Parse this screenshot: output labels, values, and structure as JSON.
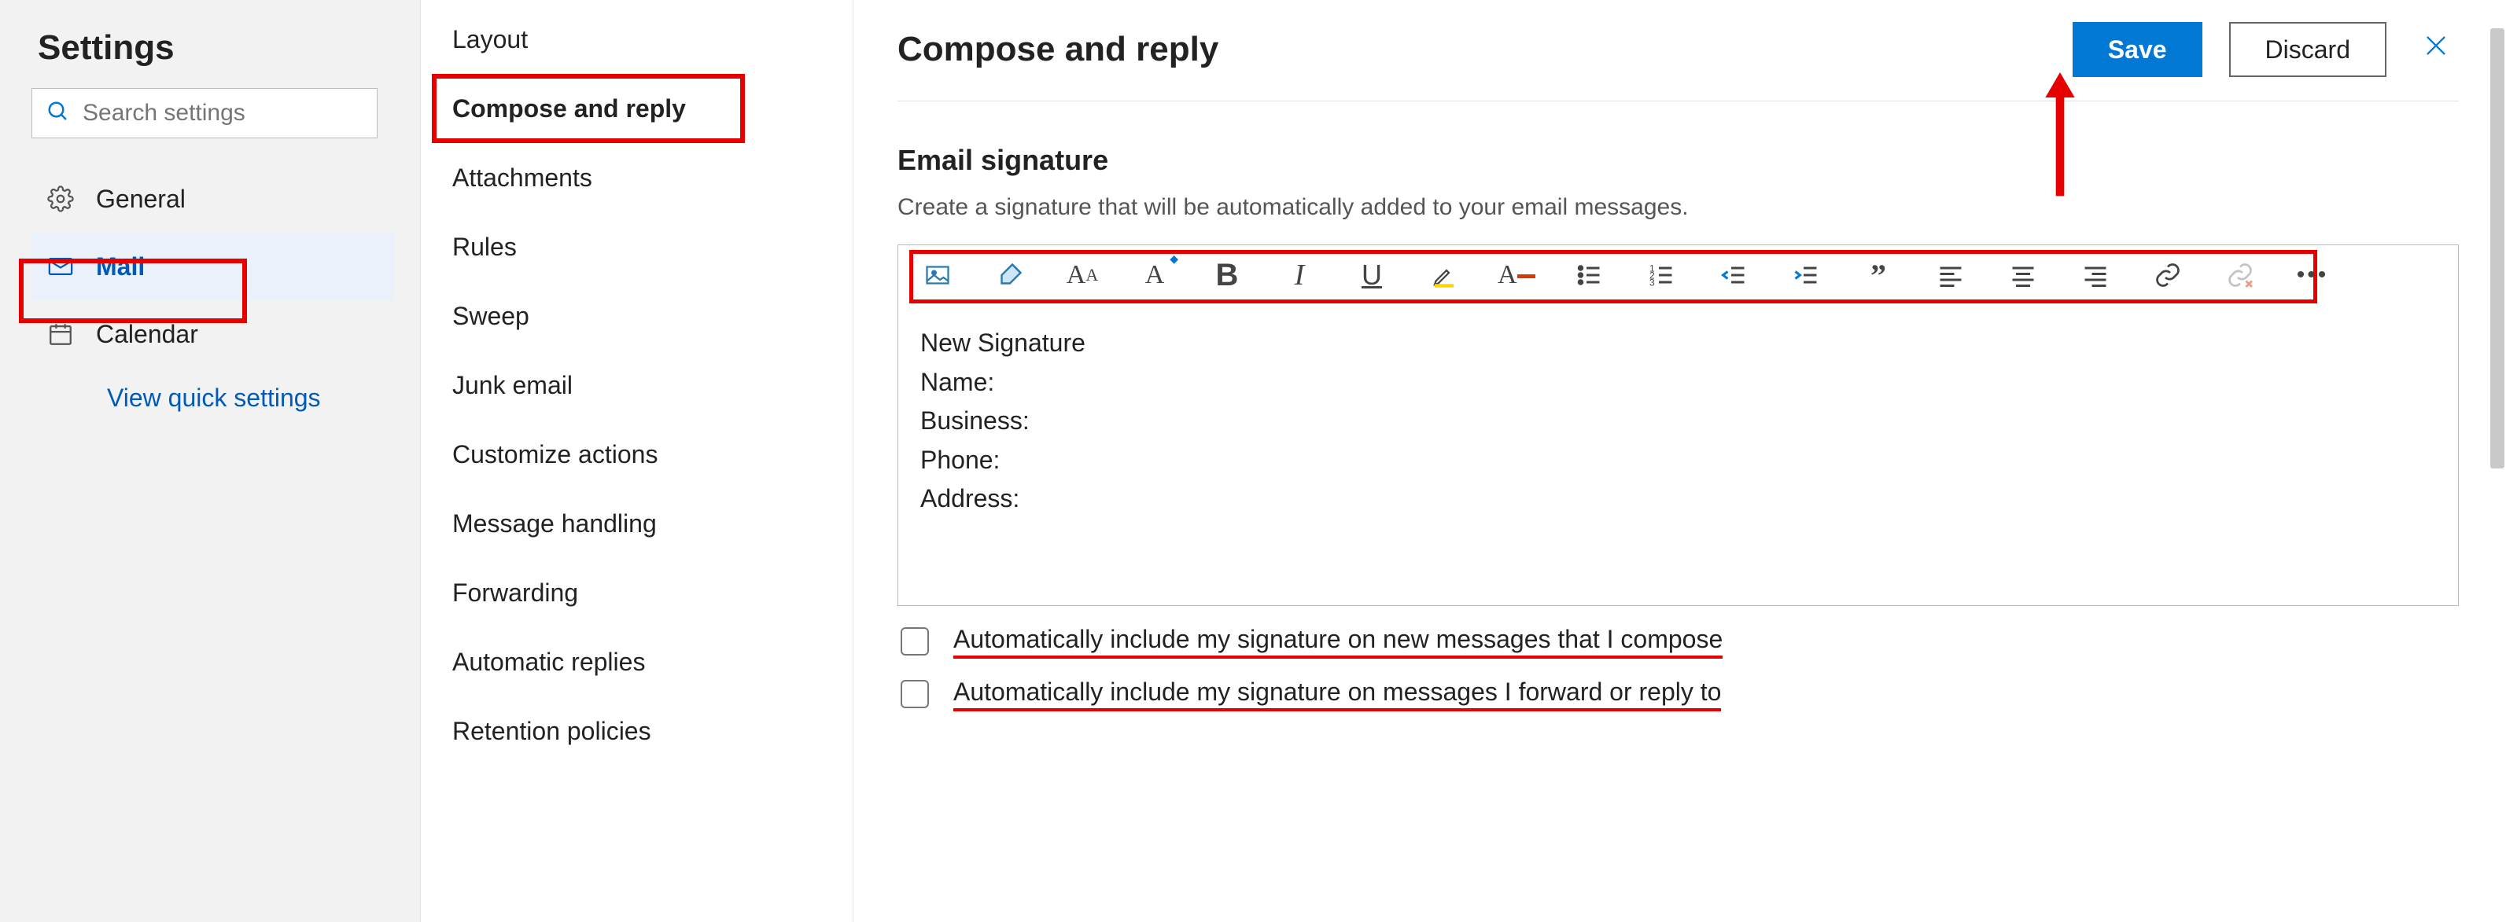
{
  "sidebar1": {
    "title": "Settings",
    "search_placeholder": "Search settings",
    "items": [
      {
        "label": "General"
      },
      {
        "label": "Mail"
      },
      {
        "label": "Calendar"
      }
    ],
    "quick_link": "View quick settings"
  },
  "sidebar2": {
    "items": [
      "Layout",
      "Compose and reply",
      "Attachments",
      "Rules",
      "Sweep",
      "Junk email",
      "Customize actions",
      "Message handling",
      "Forwarding",
      "Automatic replies",
      "Retention policies"
    ]
  },
  "main": {
    "title": "Compose and reply",
    "save_label": "Save",
    "discard_label": "Discard",
    "section_title": "Email signature",
    "section_desc": "Create a signature that will be automatically added to your email messages.",
    "signature_body": "New Signature\nName:\nBusiness:\nPhone:\nAddress:",
    "check1": "Automatically include my signature on new messages that I compose",
    "check2": "Automatically include my signature on messages I forward or reply to"
  },
  "toolbar_icons": [
    "insert-image-icon",
    "format-painter-icon",
    "font-icon",
    "font-size-icon",
    "bold-icon",
    "italic-icon",
    "underline-icon",
    "highlight-icon",
    "font-color-icon",
    "bullet-list-icon",
    "numbered-list-icon",
    "outdent-icon",
    "indent-icon",
    "quote-icon",
    "align-left-icon",
    "align-center-icon",
    "align-right-icon",
    "insert-link-icon",
    "remove-link-icon",
    "more-options-icon"
  ],
  "colors": {
    "accent": "#0078d4",
    "red": "#e60000",
    "link": "#005bb8"
  }
}
